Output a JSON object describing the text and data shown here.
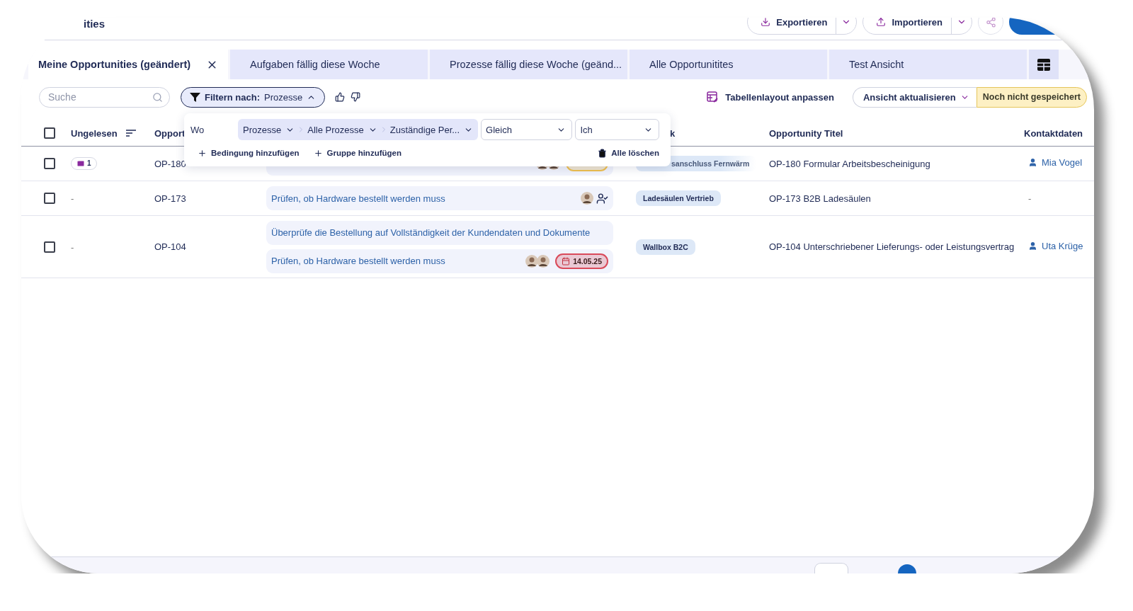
{
  "header": {
    "title": "ities",
    "buttons": [
      {
        "label": "Exportieren",
        "kind": "export"
      },
      {
        "label": "Importieren",
        "kind": "import"
      }
    ]
  },
  "tabs": [
    {
      "label": "Meine Opportunities (geändert)",
      "selected": true
    },
    {
      "label": "Aufgaben fällig diese Woche",
      "selected": false
    },
    {
      "label": "Prozesse fällig diese Woche (geänd...",
      "selected": false
    },
    {
      "label": "Alle Opportunitites",
      "selected": false
    },
    {
      "label": "Test Ansicht",
      "selected": false
    }
  ],
  "toolbar": {
    "search": {
      "placeholder": "Suche"
    },
    "filter": {
      "label": "Filtern nach:",
      "value": "Prozesse",
      "expanded": true
    },
    "layout_button": "Tabellenlayout anpassen",
    "view_button": "Ansicht aktualisieren",
    "save_status": "Noch nicht gespeichert"
  },
  "filter_popup": {
    "where": "Wo",
    "path": [
      "Prozesse",
      "Alle Prozesse",
      "Zuständige Per..."
    ],
    "operator": "Gleich",
    "value": "Ich",
    "add_condition": "Bedingung hinzufügen",
    "add_group": "Gruppe hinzufügen",
    "clear_all": "Alle löschen"
  },
  "table": {
    "select_all": {
      "checked": false
    },
    "columns": [
      {
        "label": "Ungelesen",
        "sortable": true
      },
      {
        "label": "Opport"
      },
      {
        "label": "k"
      },
      {
        "label": "Opportunity Titel"
      },
      {
        "label": "Kontaktdaten"
      }
    ],
    "rows": [
      {
        "checked": false,
        "unread": "1",
        "id": "OP-180",
        "tasks": [
          {
            "assignees": [
              {
                "kind": "photo"
              },
              {
                "kind": "photo"
              }
            ],
            "due": {
              "color": "#f0c04e"
            }
          }
        ],
        "tag": {
          "label": "sanschluss Fernwärm",
          "faded": true
        },
        "title": "OP-180 Formular Arbeitsbescheinigung",
        "contact": "Mia Vogel"
      },
      {
        "checked": false,
        "unread": "-",
        "id": "OP-173",
        "tasks": [
          {
            "text": "Prüfen, ob Hardware bestellt werden muss",
            "assignees": [
              {
                "kind": "photo"
              },
              {
                "kind": "assigned"
              }
            ]
          }
        ],
        "tag": {
          "label": "Ladesäulen Vertrieb",
          "faded": false
        },
        "title": "OP-173 B2B Ladesäulen",
        "contact": "-"
      },
      {
        "checked": false,
        "unread": "-",
        "id": "OP-104",
        "tasks": [
          {
            "text": "Überprüfe die Bestellung auf Vollständigkeit der Kundendaten und Dokumente"
          },
          {
            "text": "Prüfen, ob Hardware bestellt werden muss",
            "assignees": [
              {
                "kind": "photo"
              },
              {
                "kind": "photo"
              }
            ],
            "due": {
              "color": "#d94a5a",
              "date": "14.05.25"
            }
          }
        ],
        "tag": {
          "label": "Wallbox B2C",
          "faded": false
        },
        "title": "OP-104 Unterschriebener Lieferungs- oder Leistungsvertrag",
        "contact": "Uta Krüge"
      }
    ]
  }
}
